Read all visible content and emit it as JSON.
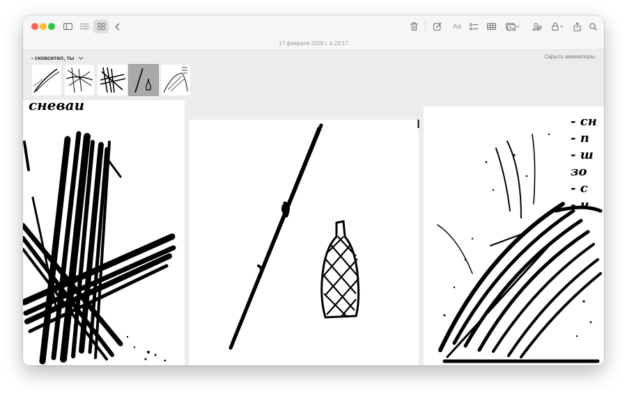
{
  "toolbar": {
    "date": "17 февраля 2026 г. в 23:17",
    "icons": [
      "sidebar-icon",
      "list-view-icon",
      "gallery-view-icon",
      "back-chevron-icon",
      "trash-icon",
      "compose-icon",
      "format-text-icon",
      "checklist-icon",
      "table-icon",
      "media-icon",
      "collaborate-icon",
      "lock-icon",
      "share-icon",
      "search-icon"
    ],
    "format_label": "Aa"
  },
  "gallery": {
    "title": "- сковситил, ты",
    "hide_thumbnails": "Скрыть миниатюры",
    "selected_index": 3,
    "thumbnails": [
      {
        "name": "thumbnail-1"
      },
      {
        "name": "thumbnail-2"
      },
      {
        "name": "thumbnail-3"
      },
      {
        "name": "thumbnail-4"
      },
      {
        "name": "thumbnail-5"
      }
    ]
  },
  "pages": {
    "left_handwriting": "сневаи",
    "right_notes": [
      "- сн",
      "- п",
      "- ш",
      "зо",
      "- с",
      "- ч"
    ]
  },
  "colors": {
    "traffic_close": "#fe5f57",
    "traffic_minimize": "#febc2e",
    "traffic_maximize": "#28c840",
    "ink": "#000000"
  }
}
